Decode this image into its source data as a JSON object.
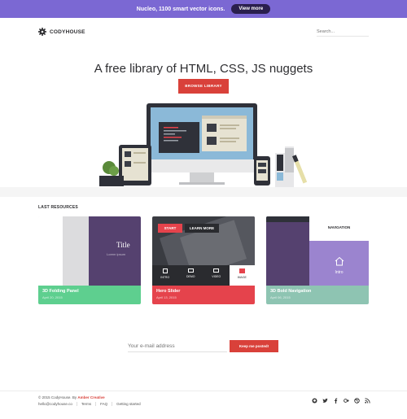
{
  "banner": {
    "text": "Nucleo, 1100 smart vector icons.",
    "button": "View more"
  },
  "header": {
    "logo": "CODYHOUSE",
    "search_placeholder": "Search..."
  },
  "hero": {
    "title": "A free library of HTML, CSS, JS nuggets",
    "button": "BROWSE LIBRARY"
  },
  "resources": {
    "title": "LAST RESOURCES",
    "cards": [
      {
        "title": "3D Folding Panel",
        "date": "April 20, 2015",
        "preview_title": "Title",
        "preview_subtitle": "Lorem ipsum",
        "color": "#5ecf8f"
      },
      {
        "title": "Hero Slider",
        "date": "April 13, 2015",
        "btn_start": "START",
        "btn_learn": "LEARN MORE",
        "nav": [
          "INTRO",
          "DEMO",
          "VIDEO",
          "IMAGE"
        ],
        "color": "#e5434c"
      },
      {
        "title": "3D Bold Navigation",
        "date": "April 06, 2015",
        "nav_label": "NAVIGATION",
        "intro_label": "Intro",
        "color": "#8ec4b2"
      }
    ]
  },
  "newsletter": {
    "placeholder": "Your e-mail address",
    "button": "Keep me posted!"
  },
  "footer": {
    "copyright": "© 2015 CodyHouse. By",
    "author": "Amber Creative",
    "links": [
      "hello@codyhouse.co",
      "Terms",
      "FAQ",
      "Getting started"
    ],
    "social": [
      "github-icon",
      "twitter-icon",
      "facebook-icon",
      "google-plus-icon",
      "dribbble-icon",
      "rss-icon"
    ]
  },
  "colors": {
    "accent": "#d9413a",
    "banner": "#7b68d3"
  }
}
